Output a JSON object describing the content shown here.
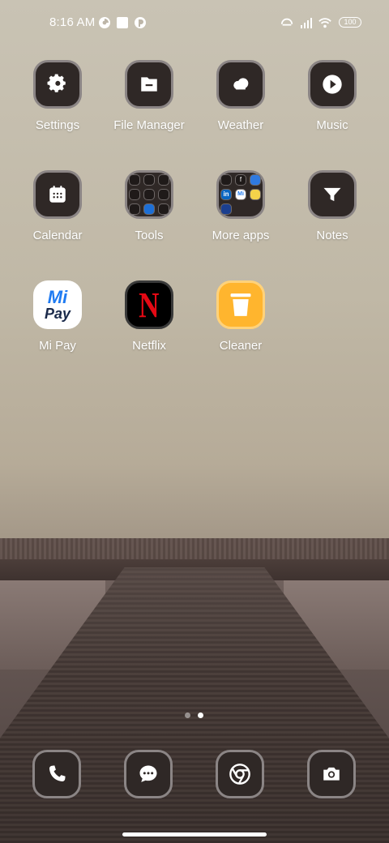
{
  "status_bar": {
    "time": "8:16 AM",
    "battery": "100",
    "icons": [
      "data-saver-icon",
      "stop-square-icon",
      "data-saver-icon",
      "hotspot-icon",
      "signal-icon",
      "wifi-icon",
      "battery-icon"
    ]
  },
  "apps": [
    {
      "label": "Settings",
      "icon": "gear-icon"
    },
    {
      "label": "File Manager",
      "icon": "folder-icon"
    },
    {
      "label": "Weather",
      "icon": "cloud-icon"
    },
    {
      "label": "Music",
      "icon": "play-icon"
    },
    {
      "label": "Calendar",
      "icon": "calendar-icon"
    },
    {
      "label": "Tools",
      "icon": "folder-tools-icon"
    },
    {
      "label": "More apps",
      "icon": "folder-apps-icon"
    },
    {
      "label": "Notes",
      "icon": "notes-icon"
    },
    {
      "label": "Mi Pay",
      "icon": "mi-pay-icon",
      "icon_text_top": "Mi",
      "icon_text_bottom": "Pay"
    },
    {
      "label": "Netflix",
      "icon": "netflix-icon",
      "icon_text": "N"
    },
    {
      "label": "Cleaner",
      "icon": "trash-icon"
    }
  ],
  "more_apps_folder": {
    "labels": [
      "f",
      "in",
      "Mi"
    ]
  },
  "page_indicator": {
    "pages": 2,
    "current": 2
  },
  "dock": [
    {
      "icon": "phone-icon"
    },
    {
      "icon": "messages-icon"
    },
    {
      "icon": "chrome-icon"
    },
    {
      "icon": "camera-icon"
    }
  ],
  "colors": {
    "icon_bg": "#2f2826",
    "icon_border": "#8b8585",
    "netflix_red": "#e50914",
    "mipay_blue": "#1f7bf2",
    "cleaner_yellow": "#ffb52e"
  }
}
